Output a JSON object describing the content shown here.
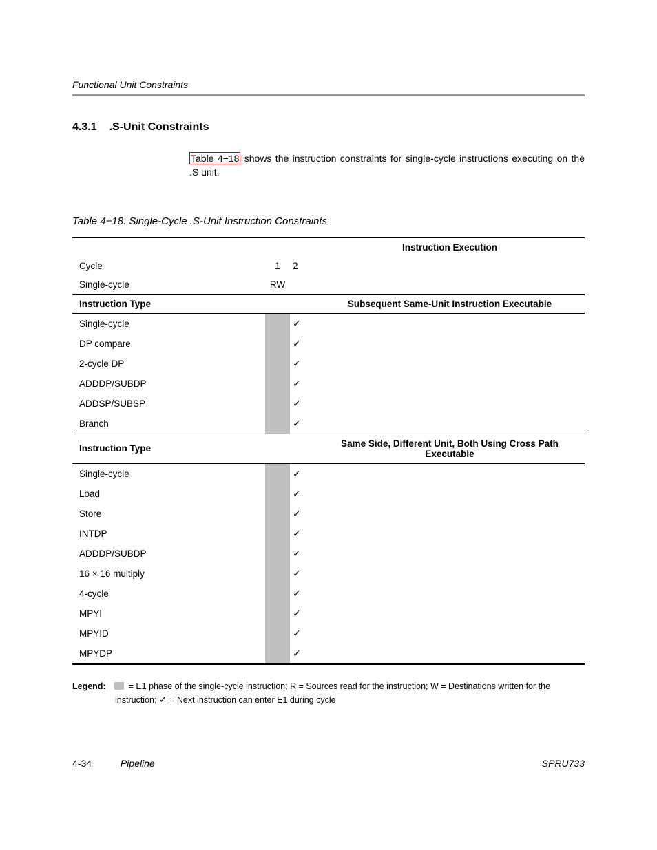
{
  "running_head": "Functional Unit Constraints",
  "section": {
    "number": "4.3.1",
    "title": ".S-Unit Constraints"
  },
  "intro": {
    "ref": "Table 4−18",
    "rest": " shows the instruction constraints for single-cycle instructions executing on the .S unit."
  },
  "table_caption": "Table 4−18.  Single-Cycle .S-Unit Instruction Constraints",
  "headers": {
    "instr_exec": "Instruction Execution",
    "cycle": "Cycle",
    "c1": "1",
    "c2": "2",
    "single_cycle": "Single-cycle",
    "rw": "RW",
    "instr_type": "Instruction Type",
    "subseq": "Subsequent Same-Unit Instruction Executable",
    "cross": "Same Side, Different Unit, Both Using Cross Path Executable"
  },
  "group1": [
    "Single-cycle",
    "DP compare",
    "2-cycle DP",
    "ADDDP/SUBDP",
    "ADDSP/SUBSP",
    "Branch"
  ],
  "group2": [
    "Single-cycle",
    "Load",
    "Store",
    "INTDP",
    "ADDDP/SUBDP",
    "16 × 16 multiply",
    "4-cycle",
    "MPYI",
    "MPYID",
    "MPYDP"
  ],
  "check": "✓",
  "legend": {
    "label": "Legend:",
    "line1a": " = E1 phase of the single-cycle instruction; R = Sources read for the instruction; W = Destinations written for the",
    "line2": "instruction; ",
    "line2b": " = Next instruction can enter E1 during cycle"
  },
  "footer": {
    "pagenum": "4-34",
    "chapter": "Pipeline",
    "docnum": "SPRU733"
  }
}
